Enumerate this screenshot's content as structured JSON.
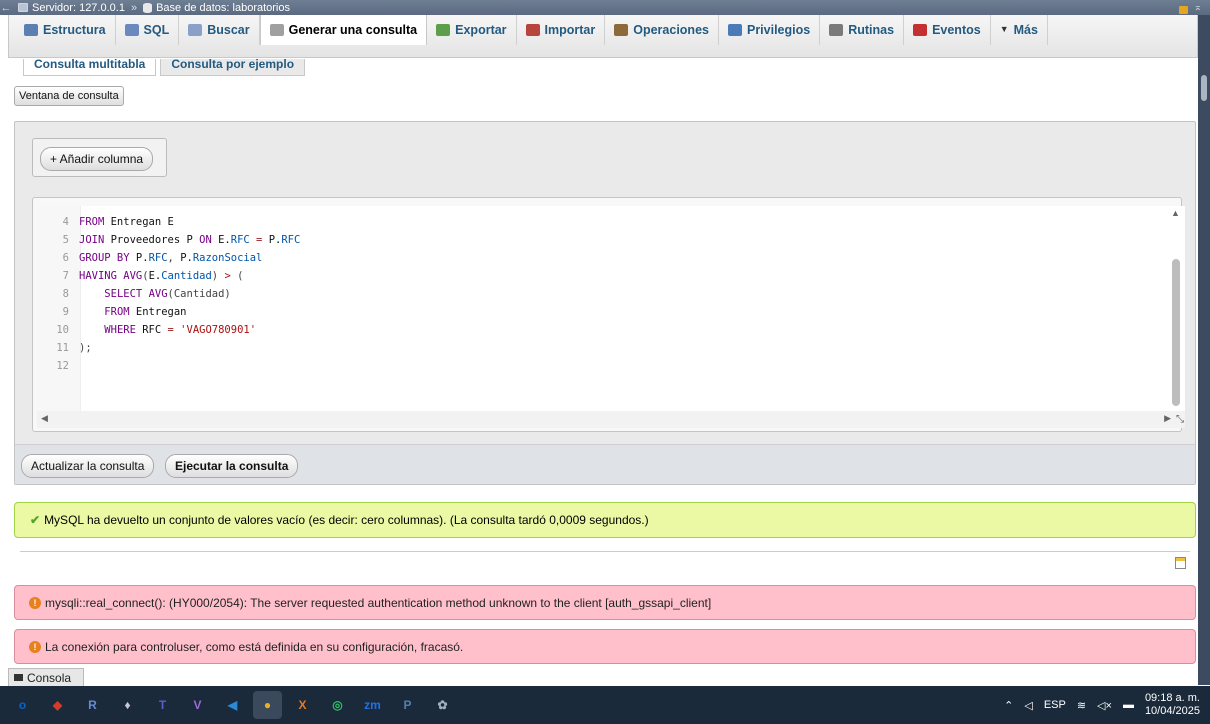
{
  "breadcrumb": {
    "server": "Servidor: 127.0.0.1",
    "separator": "»",
    "database": "Base de datos: laboratorios"
  },
  "tabs": [
    {
      "label": "Estructura",
      "icon": "structure-icon",
      "color": "#5a7fb0"
    },
    {
      "label": "SQL",
      "icon": "sql-icon",
      "color": "#6a8abf"
    },
    {
      "label": "Buscar",
      "icon": "search-icon",
      "color": "#8aa0c8"
    },
    {
      "label": "Generar una consulta",
      "icon": "query-icon",
      "color": "#a0a0a0"
    },
    {
      "label": "Exportar",
      "icon": "export-icon",
      "color": "#5d9e4a"
    },
    {
      "label": "Importar",
      "icon": "import-icon",
      "color": "#b8443e"
    },
    {
      "label": "Operaciones",
      "icon": "wrench-icon",
      "color": "#8c6a3a"
    },
    {
      "label": "Privilegios",
      "icon": "privileges-icon",
      "color": "#4a7ab8"
    },
    {
      "label": "Rutinas",
      "icon": "routines-icon",
      "color": "#7a7a7a"
    },
    {
      "label": "Eventos",
      "icon": "clock-icon",
      "color": "#c43030"
    },
    {
      "label": "Más",
      "icon": "chevron-down-icon",
      "color": "#235a81"
    }
  ],
  "active_tab_index": 3,
  "subtabs": [
    "Consulta multitabla",
    "Consulta por ejemplo"
  ],
  "query_window_button": "Ventana de consulta",
  "add_column_button": "+ Añadir columna",
  "sql_lines": [
    {
      "n": "4",
      "parts": [
        {
          "t": "FROM ",
          "c": "kw"
        },
        {
          "t": "Entregan E",
          "c": "tb"
        }
      ]
    },
    {
      "n": "5",
      "parts": [
        {
          "t": "JOIN ",
          "c": "kw"
        },
        {
          "t": "Proveedores P ",
          "c": "tb"
        },
        {
          "t": "ON ",
          "c": "kw"
        },
        {
          "t": "E.",
          "c": "tb"
        },
        {
          "t": "RFC",
          "c": "fld"
        },
        {
          "t": " = ",
          "c": "op"
        },
        {
          "t": "P.",
          "c": "tb"
        },
        {
          "t": "RFC",
          "c": "fld"
        }
      ]
    },
    {
      "n": "6",
      "parts": [
        {
          "t": "GROUP BY ",
          "c": "kw"
        },
        {
          "t": "P.",
          "c": "tb"
        },
        {
          "t": "RFC",
          "c": "fld"
        },
        {
          "t": ", ",
          "c": "pn"
        },
        {
          "t": "P.",
          "c": "tb"
        },
        {
          "t": "RazonSocial",
          "c": "fld"
        }
      ]
    },
    {
      "n": "7",
      "parts": [
        {
          "t": "HAVING ",
          "c": "kw"
        },
        {
          "t": "AVG",
          "c": "kw"
        },
        {
          "t": "(",
          "c": "pn"
        },
        {
          "t": "E.",
          "c": "tb"
        },
        {
          "t": "Cantidad",
          "c": "fld"
        },
        {
          "t": ") ",
          "c": "pn"
        },
        {
          "t": ">",
          "c": "op"
        },
        {
          "t": " (",
          "c": "pn"
        }
      ]
    },
    {
      "n": "8",
      "parts": [
        {
          "t": "    ",
          "c": "pn"
        },
        {
          "t": "SELECT ",
          "c": "kw"
        },
        {
          "t": "AVG",
          "c": "kw"
        },
        {
          "t": "(Cantidad)",
          "c": "pn"
        }
      ]
    },
    {
      "n": "9",
      "parts": [
        {
          "t": "    ",
          "c": "pn"
        },
        {
          "t": "FROM ",
          "c": "kw"
        },
        {
          "t": "Entregan",
          "c": "tb"
        }
      ]
    },
    {
      "n": "10",
      "parts": [
        {
          "t": "    ",
          "c": "pn"
        },
        {
          "t": "WHERE ",
          "c": "kw"
        },
        {
          "t": "RFC",
          "c": "tb"
        },
        {
          "t": " = ",
          "c": "op"
        },
        {
          "t": "'VAGO780901'",
          "c": "str"
        }
      ]
    },
    {
      "n": "11",
      "parts": [
        {
          "t": ");",
          "c": "pn"
        }
      ]
    },
    {
      "n": "12",
      "parts": []
    }
  ],
  "update_query_button": "Actualizar la consulta",
  "execute_query_button": "Ejecutar la consulta",
  "success_message": "MySQL ha devuelto un conjunto de valores vacío (es decir: cero columnas). (La consulta tardó 0,0009 segundos.)",
  "error_messages": [
    "mysqli::real_connect(): (HY000/2054): The server requested authentication method unknown to the client [auth_gssapi_client]",
    "La conexión para controluser, como está definida en su configuración, fracasó."
  ],
  "console_label": "Consola",
  "taskbar": {
    "apps": [
      {
        "name": "outlook-icon",
        "glyph": "o",
        "color": "#0a64c8"
      },
      {
        "name": "acrobat-icon",
        "glyph": "◆",
        "color": "#d23c28"
      },
      {
        "name": "r-icon",
        "glyph": "R",
        "color": "#6a8acf"
      },
      {
        "name": "rocket-icon",
        "glyph": "♦",
        "color": "#c8c8d0"
      },
      {
        "name": "teams-icon",
        "glyph": "T",
        "color": "#5b5fc7"
      },
      {
        "name": "vs-icon",
        "glyph": "V",
        "color": "#9a6ad8"
      },
      {
        "name": "vscode-icon",
        "glyph": "◀",
        "color": "#2a8ad8"
      },
      {
        "name": "chrome-icon",
        "glyph": "●",
        "color": "#e8b020"
      },
      {
        "name": "xampp-icon",
        "glyph": "X",
        "color": "#e87820"
      },
      {
        "name": "whatsapp-icon",
        "glyph": "◎",
        "color": "#28c060"
      },
      {
        "name": "zoom-icon",
        "glyph": "zm",
        "color": "#2070e8"
      },
      {
        "name": "postgres-icon",
        "glyph": "P",
        "color": "#5080b0"
      },
      {
        "name": "settings-icon",
        "glyph": "✿",
        "color": "#a0b0c0"
      }
    ],
    "lang": "ESP",
    "time": "09:18 a. m.",
    "date": "10/04/2025"
  }
}
